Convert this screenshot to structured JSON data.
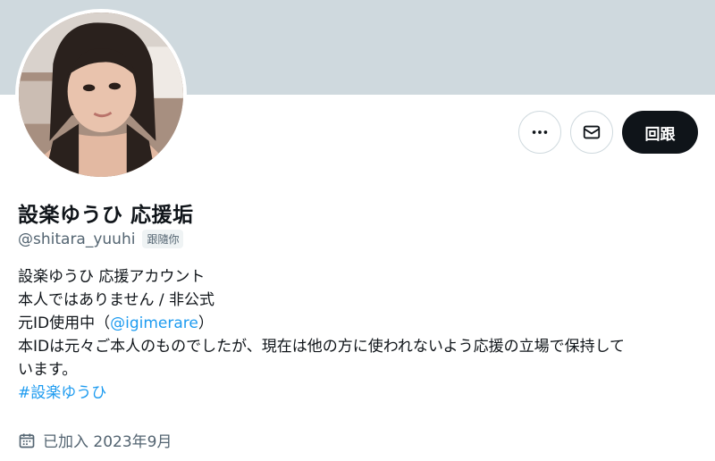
{
  "profile": {
    "display_name": "設楽ゆうひ 応援垢",
    "handle": "@shitara_yuuhi",
    "follows_you": "跟隨你"
  },
  "actions": {
    "more_icon": "more-horizontal-icon",
    "message_icon": "envelope-icon",
    "follow_label": "回跟"
  },
  "bio": {
    "line1": "設楽ゆうひ 応援アカウント",
    "line2": "本人ではありません / 非公式",
    "line3_prefix": "元ID使用中（",
    "line3_link": "@igimerare",
    "line3_suffix": "）",
    "line4": "本IDは元々ご本人のものでしたが、現在は他の方に使われないよう応援の立場で保持して",
    "line5": "います。",
    "hashtag": "#設楽ゆうひ"
  },
  "joined": {
    "icon": "calendar-icon",
    "text": "已加入 2023年9月"
  },
  "colors": {
    "banner": "#cfd9de",
    "link": "#1d9bf0",
    "secondary_text": "#536471",
    "primary_text": "#0f1419"
  }
}
